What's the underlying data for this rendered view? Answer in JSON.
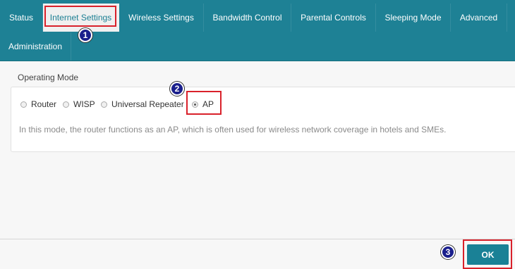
{
  "nav": {
    "tabs": [
      {
        "label": "Status"
      },
      {
        "label": "Internet Settings"
      },
      {
        "label": "Wireless Settings"
      },
      {
        "label": "Bandwidth Control"
      },
      {
        "label": "Parental Controls"
      },
      {
        "label": "Sleeping Mode"
      },
      {
        "label": "Advanced"
      },
      {
        "label": "Administration"
      }
    ]
  },
  "main": {
    "section_title": "Operating Mode",
    "modes": [
      {
        "label": "Router",
        "selected": false
      },
      {
        "label": "WISP",
        "selected": false
      },
      {
        "label": "Universal Repeater",
        "selected": false
      },
      {
        "label": "AP",
        "selected": true
      }
    ],
    "description": "In this mode, the router functions as an AP, which is often used for wireless network coverage in hotels and SMEs."
  },
  "footer": {
    "ok_label": "OK"
  },
  "annotations": {
    "markers": [
      "1",
      "2",
      "3"
    ],
    "callout_color": "#d9212b",
    "marker_color": "#1a1f8c"
  },
  "colors": {
    "nav_bg": "#1e8195",
    "accent": "#1a8196"
  }
}
